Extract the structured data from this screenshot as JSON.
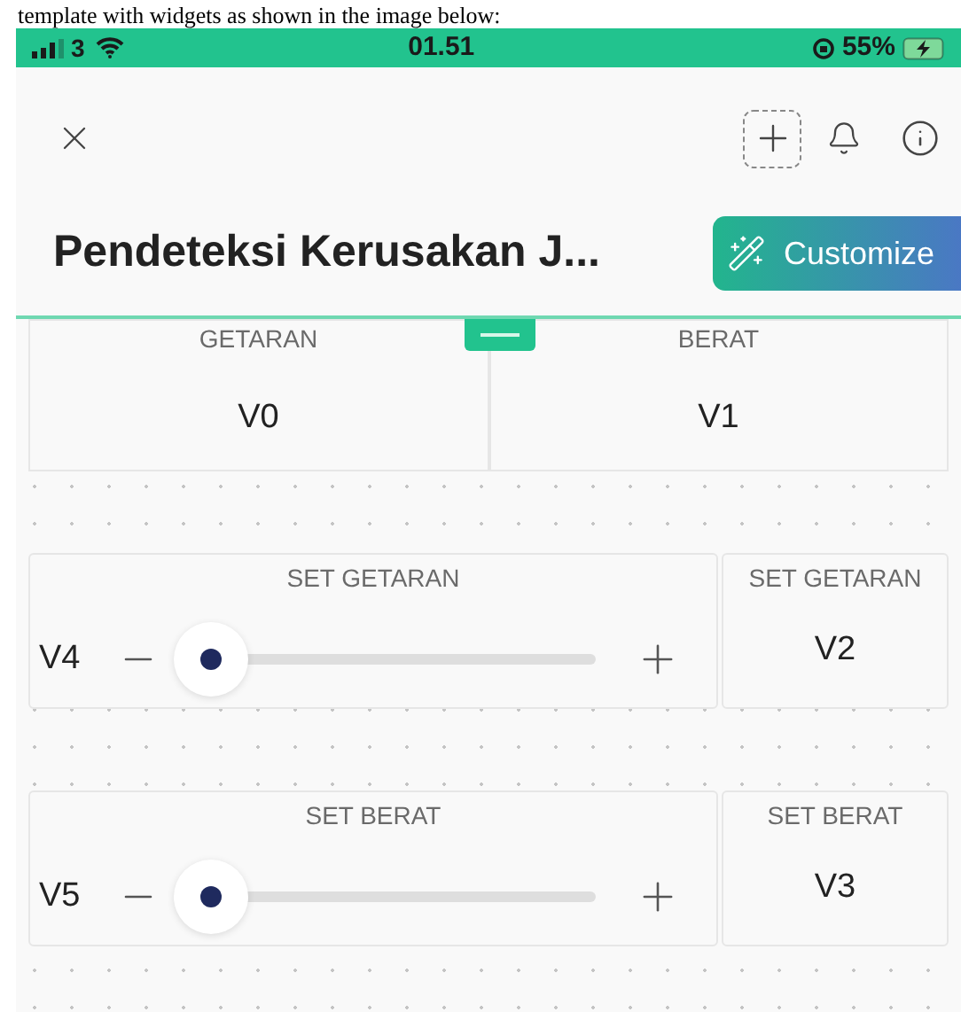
{
  "caption": "template with widgets as shown in the image below:",
  "status_bar": {
    "carrier": "3",
    "time": "01.51",
    "battery": "55%"
  },
  "title": "Pendeteksi Kerusakan J...",
  "customize_button": "Customize",
  "value_displays": [
    {
      "label": "GETARAN",
      "value": "V0"
    },
    {
      "label": "BERAT",
      "value": "V1"
    }
  ],
  "sliders": [
    {
      "label": "SET GETARAN",
      "value": "V4",
      "level": 0.03,
      "display": {
        "label": "SET GETARAN",
        "value": "V2"
      }
    },
    {
      "label": "SET BERAT",
      "value": "V5",
      "level": 0.03,
      "display": {
        "label": "SET BERAT",
        "value": "V3"
      }
    }
  ]
}
